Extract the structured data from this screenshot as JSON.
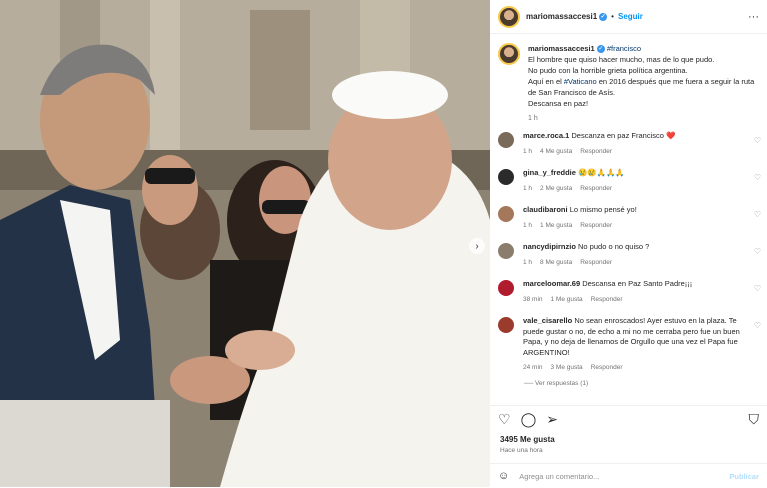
{
  "post": {
    "username": "mariomassaccesi1",
    "follow_label": "Seguir",
    "more_icon": "more-horizontal-icon"
  },
  "caption": {
    "username": "mariomassaccesi1",
    "hashtag": "#francisco",
    "line1": "El hombre que quiso hacer mucho, mas de lo que pudo.",
    "line2": "No pudo con la horrible grieta política argentina.",
    "line3_prefix": "Aquí en el ",
    "line3_tag": "#Vaticano",
    "line3_rest": " en 2016 después que me fuera a seguir la ruta de San Francisco de Asís.",
    "line4": "Descansa en paz!",
    "time": "1 h"
  },
  "comments": [
    {
      "user": "marce.roca.1",
      "text": "Descanza en paz Francisco ❤️",
      "time": "1 h",
      "likes": "4 Me gusta",
      "reply": "Responder",
      "color": "#7a6a5a"
    },
    {
      "user": "gina_y_freddie",
      "text": "😢😢🙏🙏🙏",
      "time": "1 h",
      "likes": "2 Me gusta",
      "reply": "Responder",
      "color": "#2b2b2b"
    },
    {
      "user": "claudibaroni",
      "text": "Lo mismo pensé yo!",
      "time": "1 h",
      "likes": "1 Me gusta",
      "reply": "Responder",
      "color": "#a5785c"
    },
    {
      "user": "nancydipirnzio",
      "text": "No pudo o no quiso ?",
      "time": "1 h",
      "likes": "8 Me gusta",
      "reply": "Responder",
      "color": "#8b7d6b"
    },
    {
      "user": "marceloomar.69",
      "text": "Descansa en Paz Santo Padre¡¡¡",
      "time": "38 min",
      "likes": "1 Me gusta",
      "reply": "Responder",
      "color": "#b01c2e"
    },
    {
      "user": "vale_cisarello",
      "text": "No sean enroscados! Ayer estuvo en la plaza. Te puede gustar o no, de echo a mi no me cerraba pero fue un buen Papa, y no deja de llenarnos de Orgullo que una vez el Papa fue ARGENTINO!",
      "time": "24 min",
      "likes": "3 Me gusta",
      "reply": "Responder",
      "color": "#9a3b2c"
    }
  ],
  "view_replies": "Ver respuestas (1)",
  "likes_count": "3495 Me gusta",
  "posted_ago": "Hace una hora",
  "add_comment_placeholder": "Agrega un comentario...",
  "publish_label": "Publicar"
}
